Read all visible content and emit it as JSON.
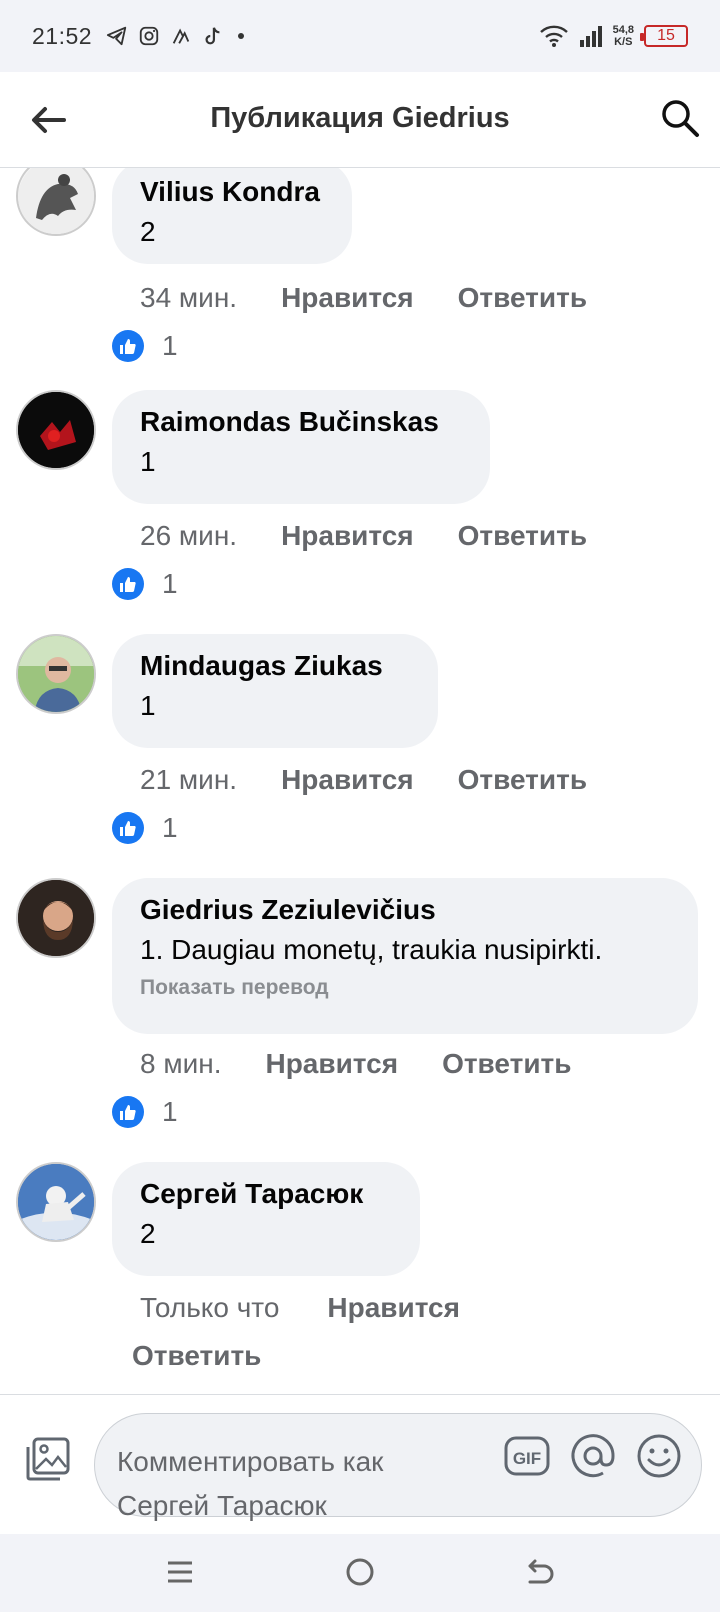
{
  "status_bar": {
    "time": "21:52",
    "net_speed_top": "54,8",
    "net_speed_bottom": "K/S",
    "battery": "15"
  },
  "header": {
    "title": "Публикация Giedrius"
  },
  "comments": [
    {
      "author": "Vilius Kondra",
      "text": "2",
      "time": "34 мин.",
      "like_label": "Нравится",
      "reply_label": "Ответить",
      "likes": "1"
    },
    {
      "author": "Raimondas Bučinskas",
      "text": "1",
      "time": "26 мин.",
      "like_label": "Нравится",
      "reply_label": "Ответить",
      "likes": "1"
    },
    {
      "author": "Mindaugas Ziukas",
      "text": "1",
      "time": "21 мин.",
      "like_label": "Нравится",
      "reply_label": "Ответить",
      "likes": "1"
    },
    {
      "author": "Giedrius Zeziulevičius",
      "text": "1. Daugiau monetų, traukia nusipirkti.",
      "translate": "Показать перевод",
      "time": "8 мин.",
      "like_label": "Нравится",
      "reply_label": "Ответить",
      "likes": "1"
    },
    {
      "author": "Сергей Тарасюк",
      "text": "2",
      "time": "Только что",
      "like_label": "Нравится",
      "reply_label": "Ответить"
    }
  ],
  "composer": {
    "placeholder": "Комментировать как Сергей Тарасюк"
  },
  "colors": {
    "accent": "#1877f2",
    "bubble": "#f0f2f5",
    "muted": "#65676b"
  },
  "icons": [
    "telegram-icon",
    "instagram-icon",
    "strava-icon",
    "tiktok-icon",
    "wifi-icon",
    "signal-icon",
    "back-arrow-icon",
    "search-icon",
    "thumbs-up-icon",
    "photo-icon",
    "gif-icon",
    "at-icon",
    "emoji-icon",
    "menu-icon",
    "home-icon",
    "back-icon"
  ]
}
